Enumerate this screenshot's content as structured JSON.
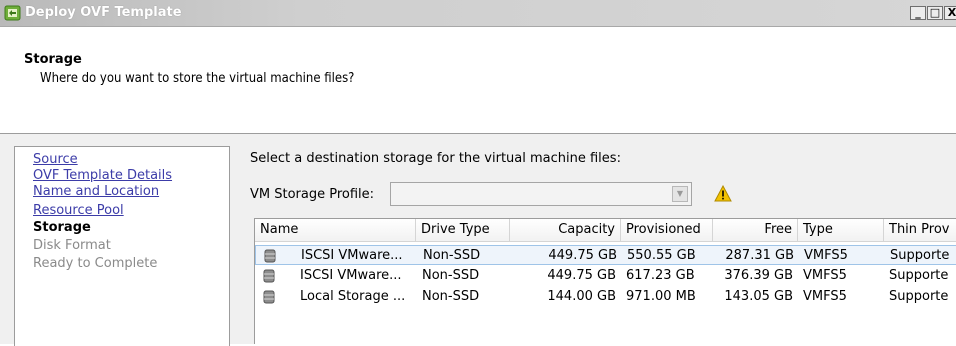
{
  "window": {
    "title": "Deploy OVF Template",
    "buttons": {
      "minimize": "_",
      "maximize": "□",
      "close": "X"
    }
  },
  "header": {
    "step_title": "Storage",
    "step_description": "Where do you want to store the virtual machine files?"
  },
  "nav": {
    "items": [
      {
        "label": "Source",
        "state": "link"
      },
      {
        "label": "OVF Template Details",
        "state": "link"
      },
      {
        "label": "Name and Location",
        "state": "link"
      },
      {
        "label": "Resource Pool",
        "state": "link"
      },
      {
        "label": "Storage",
        "state": "current"
      },
      {
        "label": "Disk Format",
        "state": "disabled"
      },
      {
        "label": "Ready to Complete",
        "state": "disabled"
      }
    ]
  },
  "main": {
    "instruction": "Select a destination storage for the virtual machine files:",
    "vm_storage_profile_label": "VM Storage Profile:",
    "vm_storage_profile_value": ""
  },
  "table": {
    "columns": [
      "Name",
      "Drive Type",
      "Capacity",
      "Provisioned",
      "Free",
      "Type",
      "Thin Prov"
    ],
    "rows": [
      {
        "name": "ISCSI VMware...",
        "drive_type": "Non-SSD",
        "capacity": "449.75 GB",
        "provisioned": "550.55 GB",
        "free": "287.31 GB",
        "type": "VMFS5",
        "thin": "Supporte",
        "selected": true
      },
      {
        "name": "ISCSI VMware...",
        "drive_type": "Non-SSD",
        "capacity": "449.75 GB",
        "provisioned": "617.23 GB",
        "free": "376.39 GB",
        "type": "VMFS5",
        "thin": "Supporte",
        "selected": false
      },
      {
        "name": "Local Storage ...",
        "drive_type": "Non-SSD",
        "capacity": "144.00 GB",
        "provisioned": "971.00 MB",
        "free": "143.05 GB",
        "type": "VMFS5",
        "thin": "Supporte",
        "selected": false
      }
    ]
  },
  "colors": {
    "link": "#3c3ca8",
    "selected_row_bg": "#eef4fb",
    "warning": "#f2c200"
  },
  "icons": {
    "app": "ovf-app-icon",
    "warning": "warning-triangle-icon",
    "datastore": "database-icon"
  }
}
